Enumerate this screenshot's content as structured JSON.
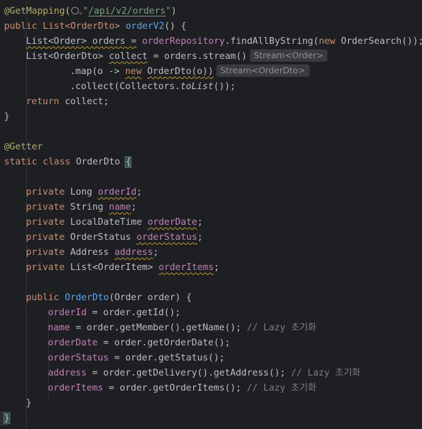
{
  "code": {
    "annotation_get_mapping": "@GetMapping",
    "endpoint": "/api/v2/orders",
    "method_header_decl": "public List<OrderDto>",
    "method_name": "orderV2",
    "method_header_tail": "() {",
    "l3_type": "List<Order> orders =",
    "l3_field": "orderRepository",
    "l3_mid": ".findAllByString(",
    "l3_new": "new",
    "l3_tail": "OrderSearch());",
    "l4_type": "List<OrderDto>",
    "l4_var": "collect",
    "l4_tail": "= orders.stream()",
    "hint_stream_order": "Stream<Order>",
    "l5_map": ".map(o ->",
    "l5_new": "new",
    "l5_tail": "OrderDto(o))",
    "hint_stream_orderdto": "Stream<OrderDto>",
    "l6_collect": ".collect(Collectors.",
    "l6_tolist": "toList",
    "l6_tail": "());",
    "l7_return": "return",
    "l7_tail": "collect;",
    "close_brace": "}",
    "annotation_getter": "@Getter",
    "class_decl_kw": "static class",
    "class_name": "OrderDto",
    "open_brace": "{",
    "fields": [
      {
        "modifier": "private",
        "type": "Long",
        "name": "orderId"
      },
      {
        "modifier": "private",
        "type": "String",
        "name": "name"
      },
      {
        "modifier": "private",
        "type": "LocalDateTime",
        "name": "orderDate"
      },
      {
        "modifier": "private",
        "type": "OrderStatus",
        "name": "orderStatus"
      },
      {
        "modifier": "private",
        "type": "Address",
        "name": "address"
      },
      {
        "modifier": "private",
        "type": "List<OrderItem>",
        "name": "orderItems"
      }
    ],
    "ctor_public": "public",
    "ctor_name": "OrderDto",
    "ctor_params": "(Order order) {",
    "assignments": [
      {
        "field": "orderId",
        "expr": "= order.getId();",
        "comment": ""
      },
      {
        "field": "name",
        "expr": "= order.getMember().getName();",
        "comment": "// Lazy 초기화"
      },
      {
        "field": "orderDate",
        "expr": "= order.getOrderDate();",
        "comment": ""
      },
      {
        "field": "orderStatus",
        "expr": "= order.getStatus();",
        "comment": ""
      },
      {
        "field": "address",
        "expr": "= order.getDelivery().getAddress();",
        "comment": "// Lazy 초기화"
      },
      {
        "field": "orderItems",
        "expr": "= order.getOrderItems();",
        "comment": "// Lazy 초기화"
      }
    ],
    "semicolon": ";",
    "space": " ",
    "open_paren": "(",
    "quote": "\"",
    "close_paren_quote": "\")"
  },
  "colors": {
    "background": "#1e1f22",
    "keyword": "#cf8e6d",
    "field": "#c77dbb",
    "method_decl": "#56a8f5",
    "string": "#6aab73",
    "annotation": "#b3ae60",
    "comment": "#7a7e85",
    "default": "#bcbec4"
  },
  "icons": [
    "globe-icon",
    "chevron-down-icon"
  ]
}
